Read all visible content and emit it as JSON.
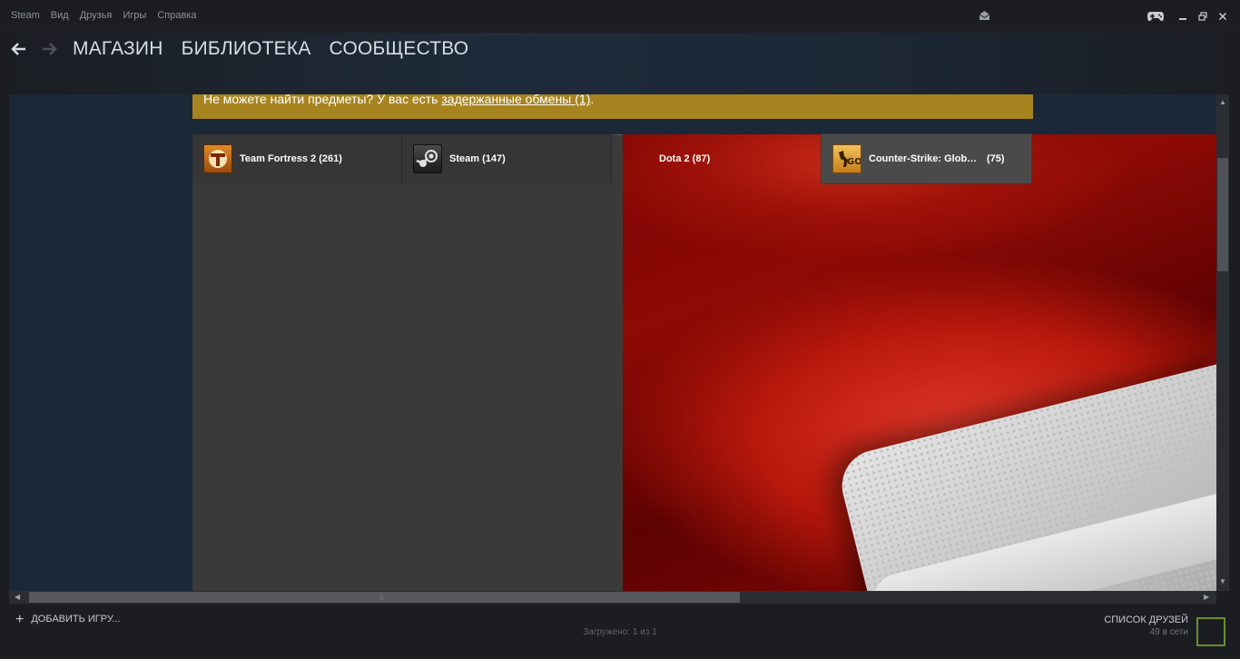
{
  "menu": [
    "Steam",
    "Вид",
    "Друзья",
    "Игры",
    "Справка"
  ],
  "nav": {
    "tabs": [
      "МАГАЗИН",
      "БИБЛИОТЕКА",
      "СООБЩЕСТВО"
    ]
  },
  "banner": {
    "text": "Не можете найти предметы? У вас есть ",
    "link": "задержанные обмены (1)",
    "suffix": "."
  },
  "games": [
    {
      "name": "Team Fortress 2 (261)",
      "icon": "tf2-icon"
    },
    {
      "name": "Steam (147)",
      "icon": "steam-icon"
    },
    {
      "name": "Dota 2 (87)",
      "icon": "none"
    },
    {
      "name": "Counter-Strike: Global Offensive",
      "count": "(75)",
      "icon": "csgo-icon"
    }
  ],
  "footer": {
    "add_game": "ДОБАВИТЬ ИГРУ...",
    "loaded": "Загружено: 1 из 1",
    "friends_label": "СПИСОК ДРУЗЕЙ",
    "friends_online": "49 в сети"
  },
  "colors": {
    "banner": "#a7841f",
    "content_bg": "#1b2838",
    "friends_border": "#6b8e2f"
  }
}
